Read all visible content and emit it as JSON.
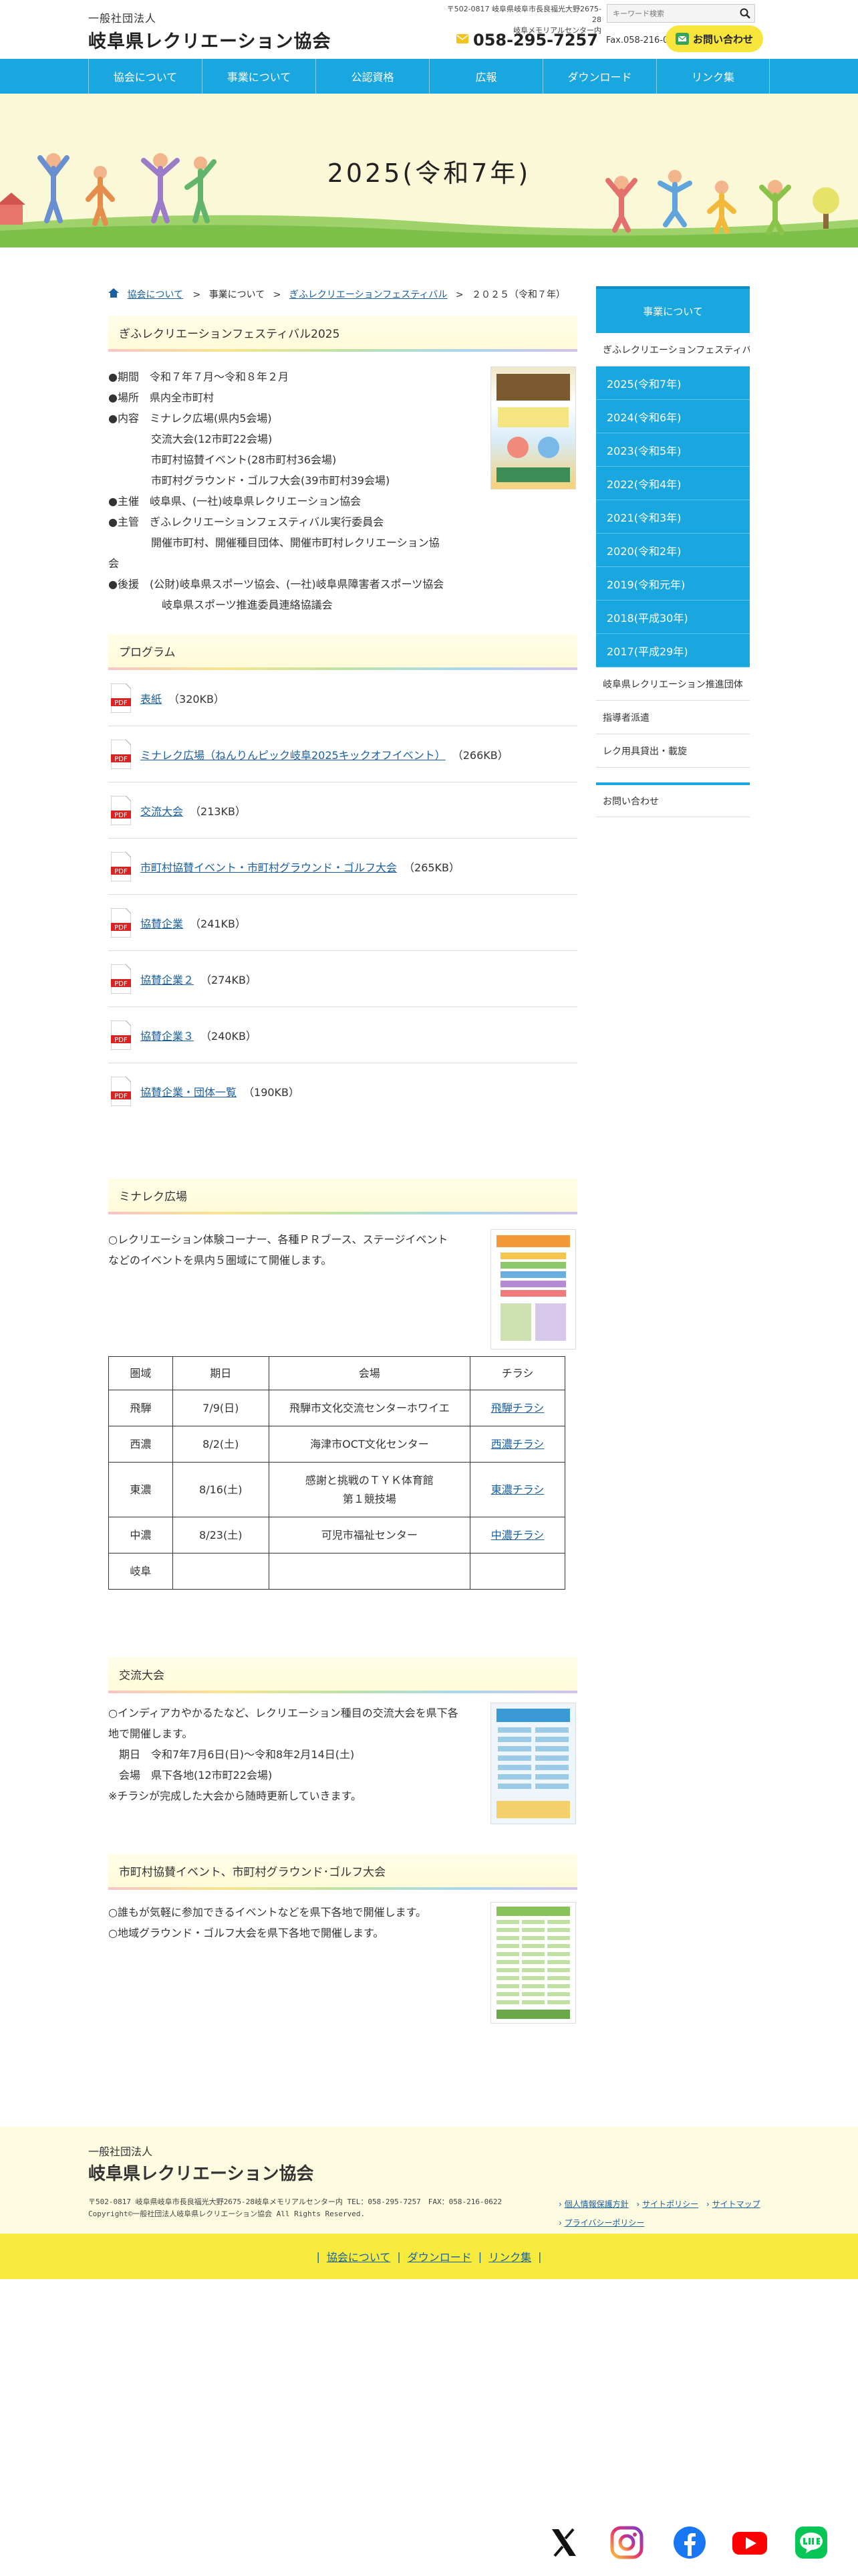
{
  "header": {
    "logo_sub": "一般社団法人",
    "logo_main": "岐阜県レクリエーション協会",
    "address_line1": "〒502-0817 岐阜県岐阜市長良福光大野2675-28",
    "address_line2": "岐阜メモリアルセンター内",
    "search_placeholder": "キーワード検索",
    "tel": "058-295-7257",
    "fax": "Fax.058-216-0622",
    "contact_label": "お問い合わせ"
  },
  "nav": [
    "協会について",
    "事業について",
    "公認資格",
    "広報",
    "ダウンロード",
    "リンク集"
  ],
  "hero": {
    "title": "2025(令和7年)"
  },
  "breadcrumb": {
    "home": "協会について",
    "l2": "事業について",
    "l3": "ぎふレクリエーションフェスティバル",
    "current": "２０２５（令和７年）",
    "sep": ">"
  },
  "festival": {
    "heading": "ぎふレクリエーションフェスティバル2025",
    "lines": [
      "●期間　令和７年７月〜令和８年２月",
      "●場所　県内全市町村",
      "●内容　ミナレク広場(県内5会場)",
      "　　　　交流大会(12市町22会場)",
      "　　　　市町村協賛イベント(28市町村36会場)",
      "　　　　市町村グラウンド・ゴルフ大会(39市町村39会場)",
      "●主催　岐阜県、(一社)岐阜県レクリエーション協会",
      "●主管　ぎふレクリエーションフェスティバル実行委員会",
      "　　　　開催市町村、開催種目団体、開催市町村レクリエーション協",
      "会",
      "●後援　(公財)岐阜県スポーツ協会、(一社)岐阜県障害者スポーツ協会",
      "　　　　　岐阜県スポーツ推進委員連絡協議会"
    ]
  },
  "program": {
    "heading": "プログラム",
    "items": [
      {
        "label": "表紙",
        "size": "（320KB）"
      },
      {
        "label": "ミナレク広場（ねんりんピック岐阜2025キックオフイベント）",
        "size": "（266KB）"
      },
      {
        "label": "交流大会",
        "size": "（213KB）"
      },
      {
        "label": "市町村協賛イベント・市町村グラウンド・ゴルフ大会",
        "size": "（265KB）"
      },
      {
        "label": "協賛企業",
        "size": "（241KB）"
      },
      {
        "label": "協賛企業２",
        "size": "（274KB）"
      },
      {
        "label": "協賛企業３",
        "size": "（240KB）"
      },
      {
        "label": "協賛企業・団体一覧",
        "size": "（190KB）"
      }
    ],
    "pdf_text": "PDF"
  },
  "minareku": {
    "heading": "ミナレク広場",
    "text1": "○レクリエーション体験コーナー、各種ＰＲブース、ステージイベント",
    "text2": "などのイベントを県内５圏域にて開催します。",
    "table": {
      "headers": [
        "圏域",
        "期日",
        "会場",
        "チラシ"
      ],
      "rows": [
        [
          "飛騨",
          "7/9(日)",
          "飛騨市文化交流センターホワイエ",
          "飛騨チラシ"
        ],
        [
          "西濃",
          "8/2(土)",
          "海津市OCT文化センター",
          "西濃チラシ"
        ],
        [
          "東濃",
          "8/16(土)",
          "感謝と挑戦のＴＹＫ体育館",
          "東濃チラシ"
        ],
        [
          "中濃",
          "8/23(土)",
          "可児市福祉センター",
          "中濃チラシ"
        ],
        [
          "岐阜",
          "",
          "",
          ""
        ]
      ],
      "tono_venue2": "第１競技場"
    }
  },
  "koryu": {
    "heading": "交流大会",
    "lines": [
      "○インディアカやかるたなど、レクリエーション種目の交流大会を県下各",
      "地で開催します。",
      "　期日　令和7年7月6日(日)〜令和8年2月14日(土)",
      "　会場　県下各地(12市町22会場)",
      "※チラシが完成した大会から随時更新していきます。"
    ]
  },
  "shichoson": {
    "heading": "市町村協賛イベント、市町村グラウンド･ゴルフ大会",
    "lines": [
      "○誰もが気軽に参加できるイベントなどを県下各地で開催します。",
      "○地域グラウンド・ゴルフ大会を県下各地で開催します。"
    ]
  },
  "sidebar": {
    "top": "事業について",
    "festival": "ぎふレクリエーションフェスティバ",
    "years": [
      "2025(令和7年)",
      "2024(令和6年)",
      "2023(令和5年)",
      "2022(令和4年)",
      "2021(令和3年)",
      "2020(令和2年)",
      "2019(令和元年)",
      "2018(平成30年)",
      "2017(平成29年)"
    ],
    "others": [
      "岐阜県レクリエーション推進団体",
      "指導者派遣",
      "レク用具貸出・載旋"
    ],
    "contact": "お問い合わせ"
  },
  "footer": {
    "logo_sub": "一般社団法人",
    "logo_main": "岐阜県レクリエーション協会",
    "address": "〒502-0817 岐阜県岐阜市長良福光大野2675-28岐阜メモリアルセンター内 TEL：058-295-7257　FAX：058-216-0622",
    "copyright": "Copyright©一般社団法人岐阜県レクリエーション協会 All Rights Reserved.",
    "links": [
      "個人情報保護方針",
      "サイトポリシー",
      "サイトマップ",
      "プライバシーポリシー"
    ],
    "bar_links": [
      "協会について",
      "ダウンロード",
      "リンク集"
    ],
    "bar_sep": "|"
  },
  "social": [
    "x-icon",
    "instagram-icon",
    "facebook-icon",
    "youtube-icon",
    "line-icon"
  ],
  "colors": {
    "accent": "#1aa6de",
    "yellow": "#f7e53b",
    "cream": "#fbf8d8"
  }
}
